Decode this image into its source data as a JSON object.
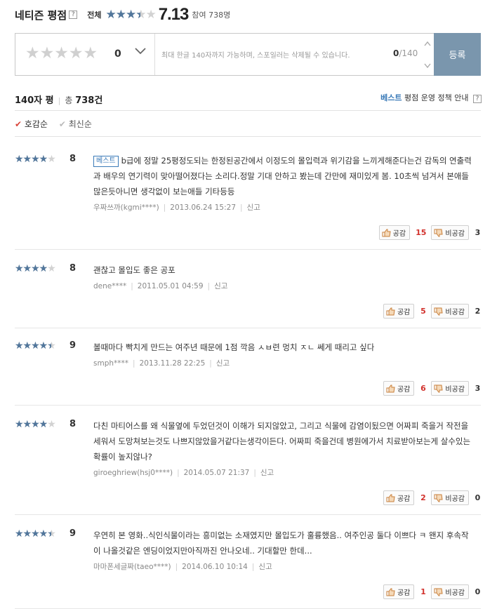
{
  "header": {
    "title": "네티즌 평점",
    "all_label": "전체",
    "stars_filled": 3.5,
    "score": "7.13",
    "participants": "참여 738명"
  },
  "input": {
    "star_glyphs": "★★★★★",
    "count": "0",
    "placeholder": "최대 한글 140자까지 가능하며, 스포일러는 삭제될 수 있습니다.",
    "length_current": "0",
    "length_max": "/140",
    "submit_label": "등록"
  },
  "summary": {
    "label_140": "140자 평",
    "total_prefix": "총",
    "total_count": "738건",
    "policy_best": "베스트",
    "policy_text": "평점 운영 정책 안내"
  },
  "sort": {
    "option1": "호감순",
    "option2": "최신순"
  },
  "vote_labels": {
    "like": "공감",
    "dislike": "비공감"
  },
  "reviews": [
    {
      "stars": 4,
      "score": "8",
      "badge": "베스트",
      "text": "b급에 정말 25평정도되는 한정된공간에서 이정도의 몰입력과 위기감을 느끼게해준다는건 감독의 연출력과 배우의 연기력이 맞아떨어졌다는 소리다.정말 기대 안하고 봤는데 간만에 재미있게 봄. 10초씩 넘겨서 본애들많은듯아니면 생각없이 보는애들 기타등등",
      "user": "우짜쓰까(kgmi****)",
      "date": "2013.06.24 15:27",
      "report": "신고",
      "likes": "15",
      "dislikes": "3"
    },
    {
      "stars": 4,
      "score": "8",
      "badge": "",
      "text": "괜찮고 몰입도 좋은 공포",
      "user": "dene****",
      "date": "2011.05.01 04:59",
      "report": "신고",
      "likes": "5",
      "dislikes": "2"
    },
    {
      "stars": 4.5,
      "score": "9",
      "badge": "",
      "text": "볼때마다 빡치게 만드는 여주년 때문에 1점 깍음 ㅅㅂ련 멍치 ㅈㄴ 쎄게 때리고 싶다",
      "user": "smph****",
      "date": "2013.11.28 22:25",
      "report": "신고",
      "likes": "6",
      "dislikes": "3"
    },
    {
      "stars": 4,
      "score": "8",
      "badge": "",
      "text": "다친 마티어스를 왜 식물옆에 두었던것이 이해가 되지않았고, 그리고 식물에 감염이됬으면 어짜피 죽을거 작전을세워서 도망쳐보는것도 나쁘지않았을거같다는생각이든다. 어짜피 죽을건데 병원에가서 치료받아보는게 살수있는 확률이 높지않나?",
      "user": "giroeghriew(hsj0****)",
      "date": "2014.05.07 21:37",
      "report": "신고",
      "likes": "2",
      "dislikes": "0"
    },
    {
      "stars": 4.5,
      "score": "9",
      "badge": "",
      "text": "우연히 본 영화..식인식물이라는 흥미없는 소재였지만 몰입도가 훌륭했음.. 여주인공 둘다 이쁘다 ㅋ 왠지 후속작이 나올것같은 엔딩이었지만아직까진 안나오네.. 기대할만 한데...",
      "user": "마마폰세글짜(taeo****)",
      "date": "2014.06.10 10:14",
      "report": "신고",
      "likes": "1",
      "dislikes": "0"
    }
  ]
}
